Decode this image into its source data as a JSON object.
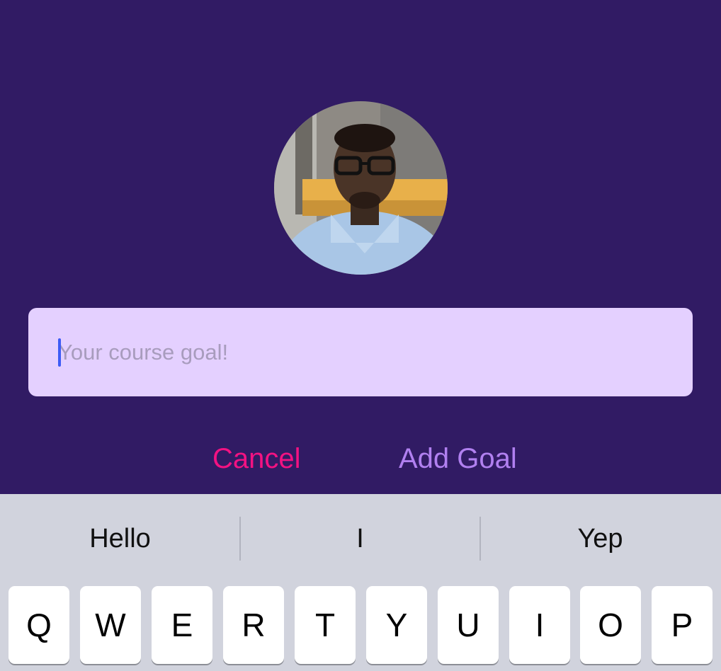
{
  "colors": {
    "background": "#311b64",
    "input_bg": "#e4d0ff",
    "cancel": "#f31282",
    "add_goal": "#b180f0",
    "keyboard_bg": "#d1d3dd"
  },
  "avatar": {
    "icon": "profile-photo"
  },
  "goal_input": {
    "placeholder": "Your course goal!",
    "value": ""
  },
  "actions": {
    "cancel_label": "Cancel",
    "add_label": "Add Goal"
  },
  "keyboard": {
    "suggestions": [
      "Hello",
      "I",
      "Yep"
    ],
    "top_row": [
      "Q",
      "W",
      "E",
      "R",
      "T",
      "Y",
      "U",
      "I",
      "O",
      "P"
    ]
  }
}
